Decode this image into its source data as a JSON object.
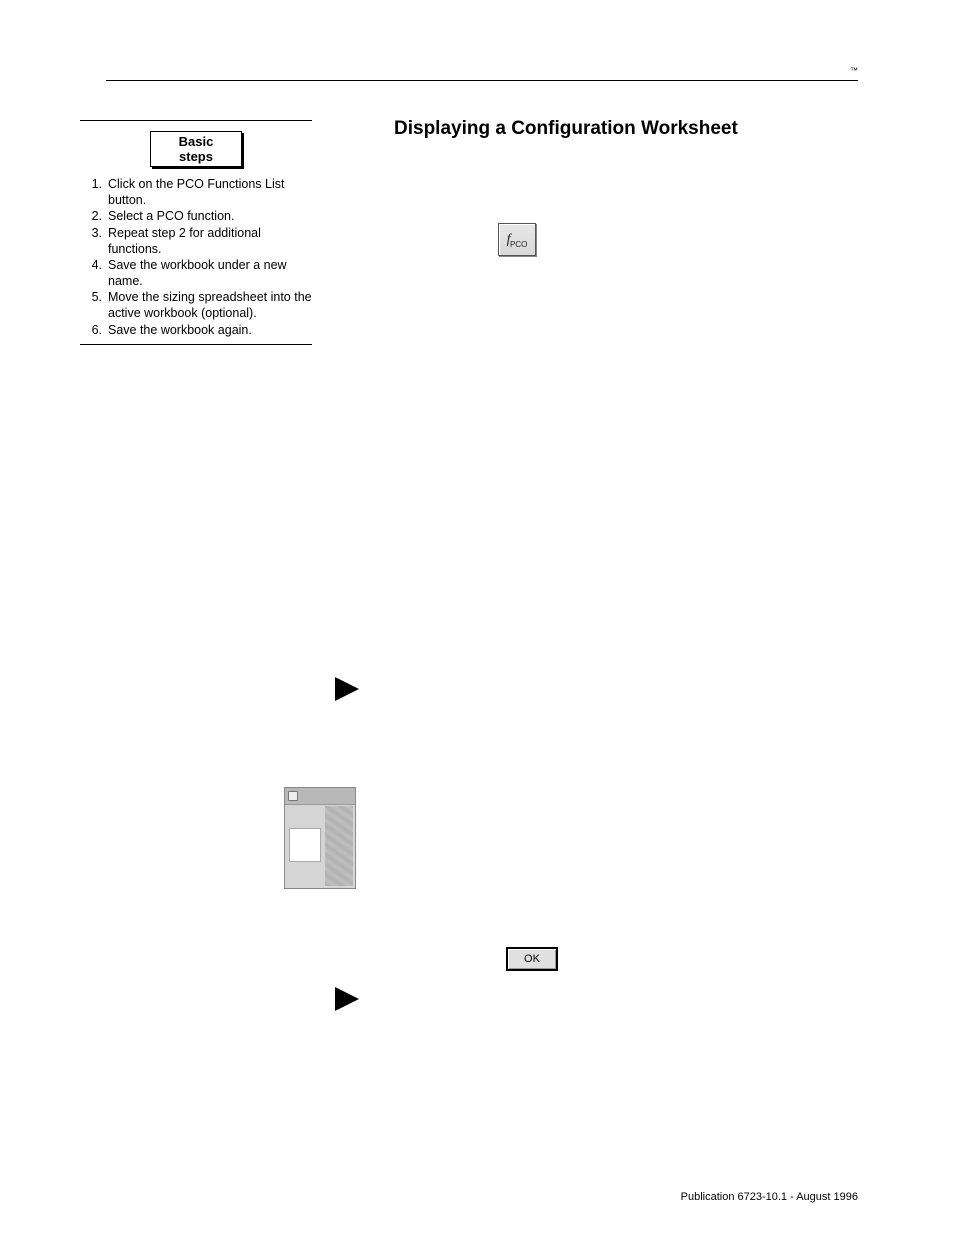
{
  "header": {
    "tm": "™"
  },
  "section_title": "Displaying a Configuration Worksheet",
  "sidebar": {
    "box_label": "Basic steps",
    "steps": [
      "Click on the PCO Functions List button.",
      "Select a PCO function.",
      "Repeat step 2 for additional functions.",
      "Save the workbook under a new name.",
      "Move the sizing spreadsheet into the active workbook (optional).",
      "Save the workbook again."
    ]
  },
  "icons": {
    "fpco_label_f": "f",
    "fpco_label_sub": "PCO",
    "ok_label": "OK"
  },
  "footer": "Publication 6723-10.1 - August 1996"
}
